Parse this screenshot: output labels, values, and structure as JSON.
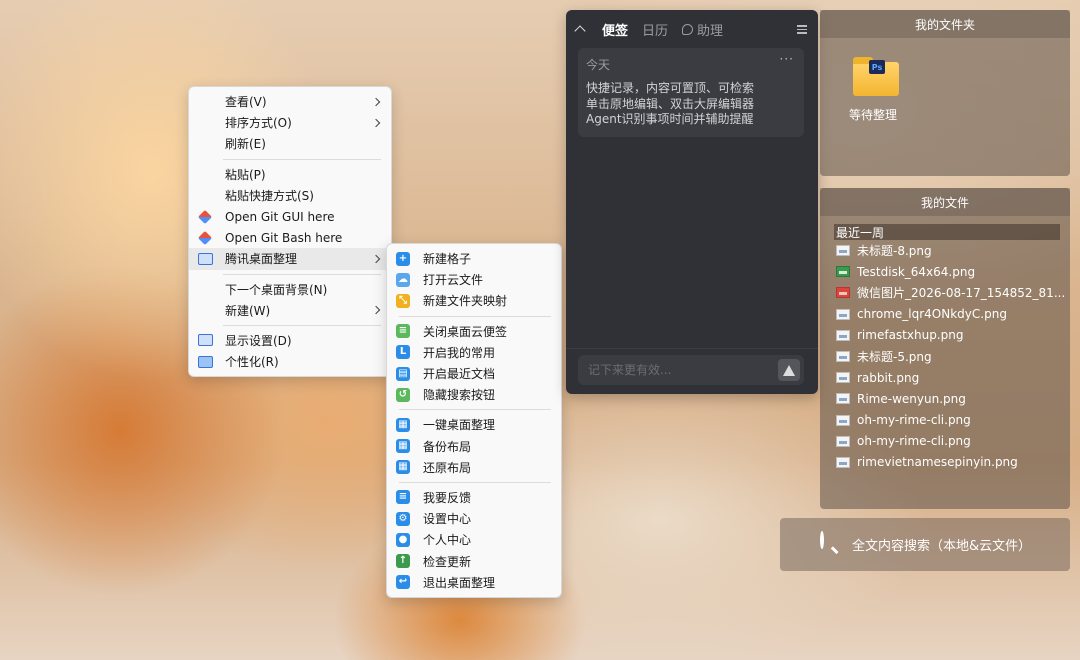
{
  "context_menu": {
    "items": [
      {
        "label": "查看(V)",
        "submenu": true
      },
      {
        "label": "排序方式(O)",
        "submenu": true
      },
      {
        "label": "刷新(E)"
      },
      {
        "label": "粘贴(P)"
      },
      {
        "label": "粘贴快捷方式(S)"
      },
      {
        "label": "Open Git GUI here",
        "icon": "git-icon"
      },
      {
        "label": "Open Git Bash here",
        "icon": "git-icon"
      },
      {
        "label": "腾讯桌面整理",
        "icon": "monitor-icon",
        "submenu": true,
        "active": true
      },
      {
        "label": "下一个桌面背景(N)"
      },
      {
        "label": "新建(W)",
        "submenu": true
      },
      {
        "label": "显示设置(D)",
        "icon": "display-settings-icon"
      },
      {
        "label": "个性化(R)",
        "icon": "personalize-icon"
      }
    ]
  },
  "submenu": {
    "accent_color": "#2a8ee8",
    "items": [
      {
        "label": "新建格子",
        "icon": "plus-icon"
      },
      {
        "label": "打开云文件",
        "icon": "cloud-icon"
      },
      {
        "label": "新建文件夹映射",
        "icon": "folder-map-icon"
      },
      {
        "label": "关闭桌面云便签",
        "icon": "note-icon"
      },
      {
        "label": "开启我的常用",
        "icon": "star-icon"
      },
      {
        "label": "开启最近文档",
        "icon": "recent-doc-icon"
      },
      {
        "label": "隐藏搜索按钮",
        "icon": "hide-search-icon"
      },
      {
        "label": "一键桌面整理",
        "icon": "organize-icon"
      },
      {
        "label": "备份布局",
        "icon": "backup-icon"
      },
      {
        "label": "还原布局",
        "icon": "restore-icon"
      },
      {
        "label": "我要反馈",
        "icon": "feedback-icon"
      },
      {
        "label": "设置中心",
        "icon": "gear-icon"
      },
      {
        "label": "个人中心",
        "icon": "user-icon"
      },
      {
        "label": "检查更新",
        "icon": "update-icon"
      },
      {
        "label": "退出桌面整理",
        "icon": "exit-icon"
      }
    ]
  },
  "notes": {
    "tabs": [
      "便签",
      "日历",
      "助理"
    ],
    "active_tab": "便签",
    "card": {
      "day": "今天",
      "more": "···",
      "lines": [
        "快捷记录，内容可置顶、可检索",
        "单击原地编辑、双击大屏编辑器",
        "Agent识别事项时间并辅助提醒"
      ]
    },
    "input_placeholder": "记下来更有效..."
  },
  "folder_fence": {
    "title": "我的文件夹",
    "items": [
      {
        "label": "等待整理",
        "badge": "Ps"
      }
    ]
  },
  "files_fence": {
    "title": "我的文件",
    "section": "最近一周",
    "files": [
      {
        "name": "未标题-8.png",
        "icon": "image-file-icon"
      },
      {
        "name": "Testdisk_64x64.png",
        "icon": "image-file-icon",
        "tone": "green"
      },
      {
        "name": "微信图片_2026-08-17_154852_81...",
        "icon": "image-file-icon",
        "tone": "red"
      },
      {
        "name": "chrome_lqr4ONkdyC.png",
        "icon": "image-file-icon"
      },
      {
        "name": "rimefastxhup.png",
        "icon": "image-file-icon"
      },
      {
        "name": "未标题-5.png",
        "icon": "image-file-icon"
      },
      {
        "name": "rabbit.png",
        "icon": "image-file-icon"
      },
      {
        "name": "Rime-wenyun.png",
        "icon": "image-file-icon"
      },
      {
        "name": "oh-my-rime-cli.png",
        "icon": "image-file-icon"
      },
      {
        "name": "oh-my-rime-cli.png",
        "icon": "image-file-icon"
      },
      {
        "name": "rimevietnamesepinyin.png",
        "icon": "image-file-icon"
      }
    ]
  },
  "search": {
    "label": "全文内容搜索（本地&云文件）",
    "icon": "search-icon"
  }
}
